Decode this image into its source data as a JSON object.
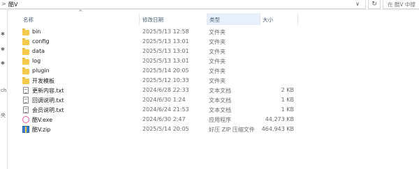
{
  "address_bar": {
    "breadcrumb_arrow": ">",
    "path_label": "酷V",
    "dropdown_glyph": "∨",
    "refresh_glyph": "↻",
    "search_placeholder": "在 酷V 中搜"
  },
  "nav_marks": [
    "✱",
    "✱",
    "✱",
    "ch",
    "央"
  ],
  "columns": {
    "name": "名称",
    "date": "修改日期",
    "type": "类型",
    "size": "大小",
    "sort_indicator": "^"
  },
  "files": [
    {
      "name": "bin",
      "date": "2025/5/13 12:58",
      "type": "文件夹",
      "size": "",
      "icon": "folder-icon"
    },
    {
      "name": "config",
      "date": "2025/5/13 13:01",
      "type": "文件夹",
      "size": "",
      "icon": "folder-icon"
    },
    {
      "name": "data",
      "date": "2025/5/13 13:01",
      "type": "文件夹",
      "size": "",
      "icon": "folder-icon"
    },
    {
      "name": "log",
      "date": "2025/5/13 13:01",
      "type": "文件夹",
      "size": "",
      "icon": "folder-icon"
    },
    {
      "name": "plugin",
      "date": "2025/5/14 20:05",
      "type": "文件夹",
      "size": "",
      "icon": "folder-icon"
    },
    {
      "name": "开发模板",
      "date": "2025/5/12 10:33",
      "type": "文件夹",
      "size": "",
      "icon": "folder-icon"
    },
    {
      "name": "更新内容.txt",
      "date": "2024/6/28 22:33",
      "type": "文本文档",
      "size": "2 KB",
      "icon": "text-file-icon"
    },
    {
      "name": "回调说明.txt",
      "date": "2024/6/30 1:24",
      "type": "文本文档",
      "size": "1 KB",
      "icon": "text-file-icon"
    },
    {
      "name": "会员说明.txt",
      "date": "2024/6/24 21:53",
      "type": "文本文档",
      "size": "1 KB",
      "icon": "text-file-icon"
    },
    {
      "name": "酷V.exe",
      "date": "2024/6/30 2:47",
      "type": "应用程序",
      "size": "44,273 KB",
      "icon": "exe-app-icon"
    },
    {
      "name": "酷V.zip",
      "date": "2025/5/14 20:05",
      "type": "好压 ZIP 压缩文件",
      "size": "464,943 KB",
      "icon": "zip-archive-icon"
    }
  ]
}
